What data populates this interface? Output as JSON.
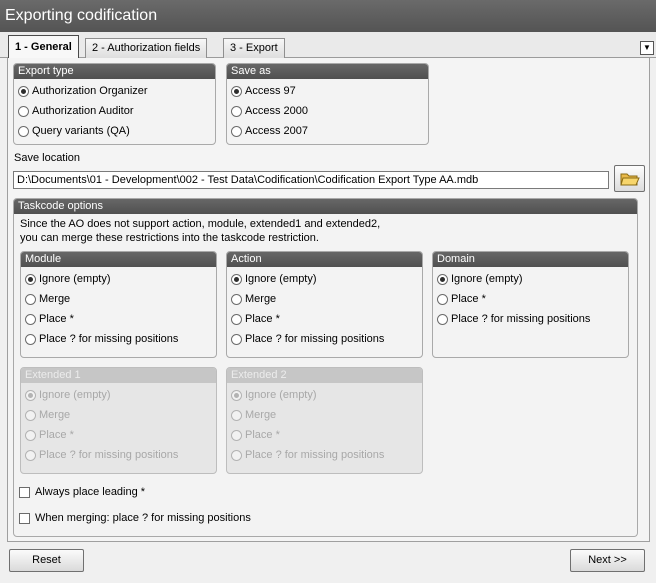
{
  "window": {
    "title": "Exporting codification"
  },
  "tabs": [
    {
      "label": "1 - General",
      "active": true
    },
    {
      "label": "2 - Authorization fields",
      "active": false
    },
    {
      "label": "3 - Export",
      "active": false
    }
  ],
  "export_type": {
    "title": "Export type",
    "options": [
      {
        "label": "Authorization Organizer",
        "selected": true
      },
      {
        "label": "Authorization Auditor",
        "selected": false
      },
      {
        "label": "Query variants (QA)",
        "selected": false
      }
    ]
  },
  "save_as": {
    "title": "Save as",
    "options": [
      {
        "label": "Access 97",
        "selected": true
      },
      {
        "label": "Access 2000",
        "selected": false
      },
      {
        "label": "Access 2007",
        "selected": false
      }
    ]
  },
  "save_location": {
    "label": "Save location",
    "value": "D:\\Documents\\01 - Development\\002 - Test Data\\Codification\\Codification Export Type AA.mdb"
  },
  "taskcode": {
    "title": "Taskcode options",
    "description_line1": "Since the AO does not support action, module, extended1 and extended2,",
    "description_line2": "you can merge these restrictions into the taskcode restriction.",
    "module": {
      "title": "Module",
      "options": [
        "Ignore (empty)",
        "Merge",
        "Place *",
        "Place ? for missing positions"
      ]
    },
    "action": {
      "title": "Action",
      "options": [
        "Ignore (empty)",
        "Merge",
        "Place *",
        "Place ? for missing positions"
      ]
    },
    "domain": {
      "title": "Domain",
      "options": [
        "Ignore (empty)",
        "Place *",
        "Place ? for missing positions"
      ]
    },
    "extended1": {
      "title": "Extended 1",
      "options": [
        "Ignore (empty)",
        "Merge",
        "Place *",
        "Place ? for missing positions"
      ]
    },
    "extended2": {
      "title": "Extended 2",
      "options": [
        "Ignore (empty)",
        "Merge",
        "Place *",
        "Place ? for missing positions"
      ]
    },
    "always_place_leading": {
      "label": "Always place leading *",
      "checked": false
    },
    "when_merging": {
      "label": "When merging: place ? for missing positions",
      "checked": false
    }
  },
  "buttons": {
    "reset": "Reset",
    "next": "Next >>"
  },
  "icons": {
    "tab_menu": "chevron-down-icon",
    "browse": "folder-open-icon"
  }
}
